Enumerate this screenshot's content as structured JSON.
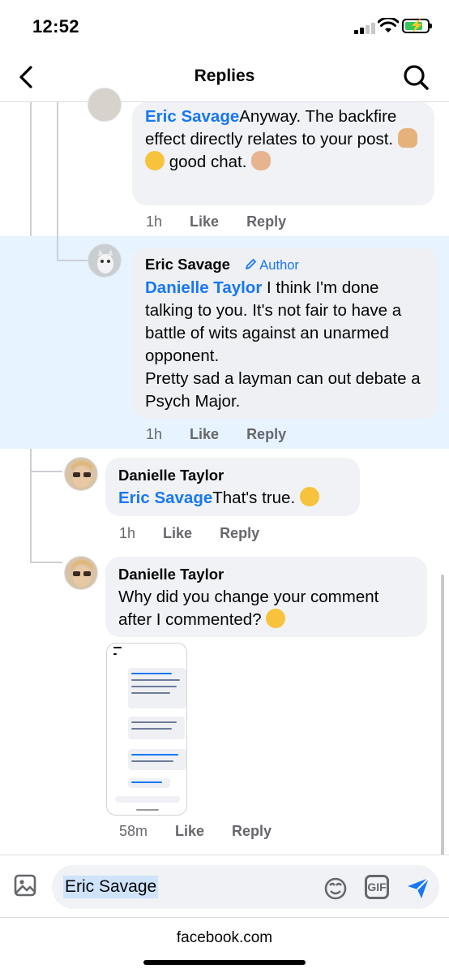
{
  "status_bar": {
    "time": "12:52"
  },
  "nav": {
    "title": "Replies"
  },
  "comments": [
    {
      "mention": "Eric Savage",
      "text": "Anyway. The backfire effect directly relates to your post.",
      "line2": "good chat.",
      "time": "1h",
      "like": "Like",
      "reply": "Reply"
    },
    {
      "author": "Eric Savage",
      "badge": "Author",
      "mention": "Danielle Taylor",
      "text": " I think I'm done talking to you. It's not fair to have a battle of wits against an unarmed opponent.",
      "line2": "Pretty sad a layman can out debate a Psych Major.",
      "time": "1h",
      "like": "Like",
      "reply": "Reply"
    },
    {
      "author": "Danielle Taylor",
      "mention": "Eric Savage",
      "text": "That's true.",
      "time": "1h",
      "like": "Like",
      "reply": "Reply"
    },
    {
      "author": "Danielle Taylor",
      "text": "Why did you change your comment after I commented?",
      "time": "58m",
      "like": "Like",
      "reply": "Reply"
    }
  ],
  "composer": {
    "value": "Eric Savage"
  },
  "browser": {
    "url": "facebook.com"
  },
  "icons": [
    "back-arrow-icon",
    "search-icon",
    "photo-icon",
    "sticker-icon",
    "gif-icon",
    "send-icon",
    "pencil-icon"
  ],
  "colors": {
    "accent": "#1877f2",
    "highlight": "#e7f3ff",
    "bubble": "#f0f2f5",
    "meta": "#65676b"
  }
}
